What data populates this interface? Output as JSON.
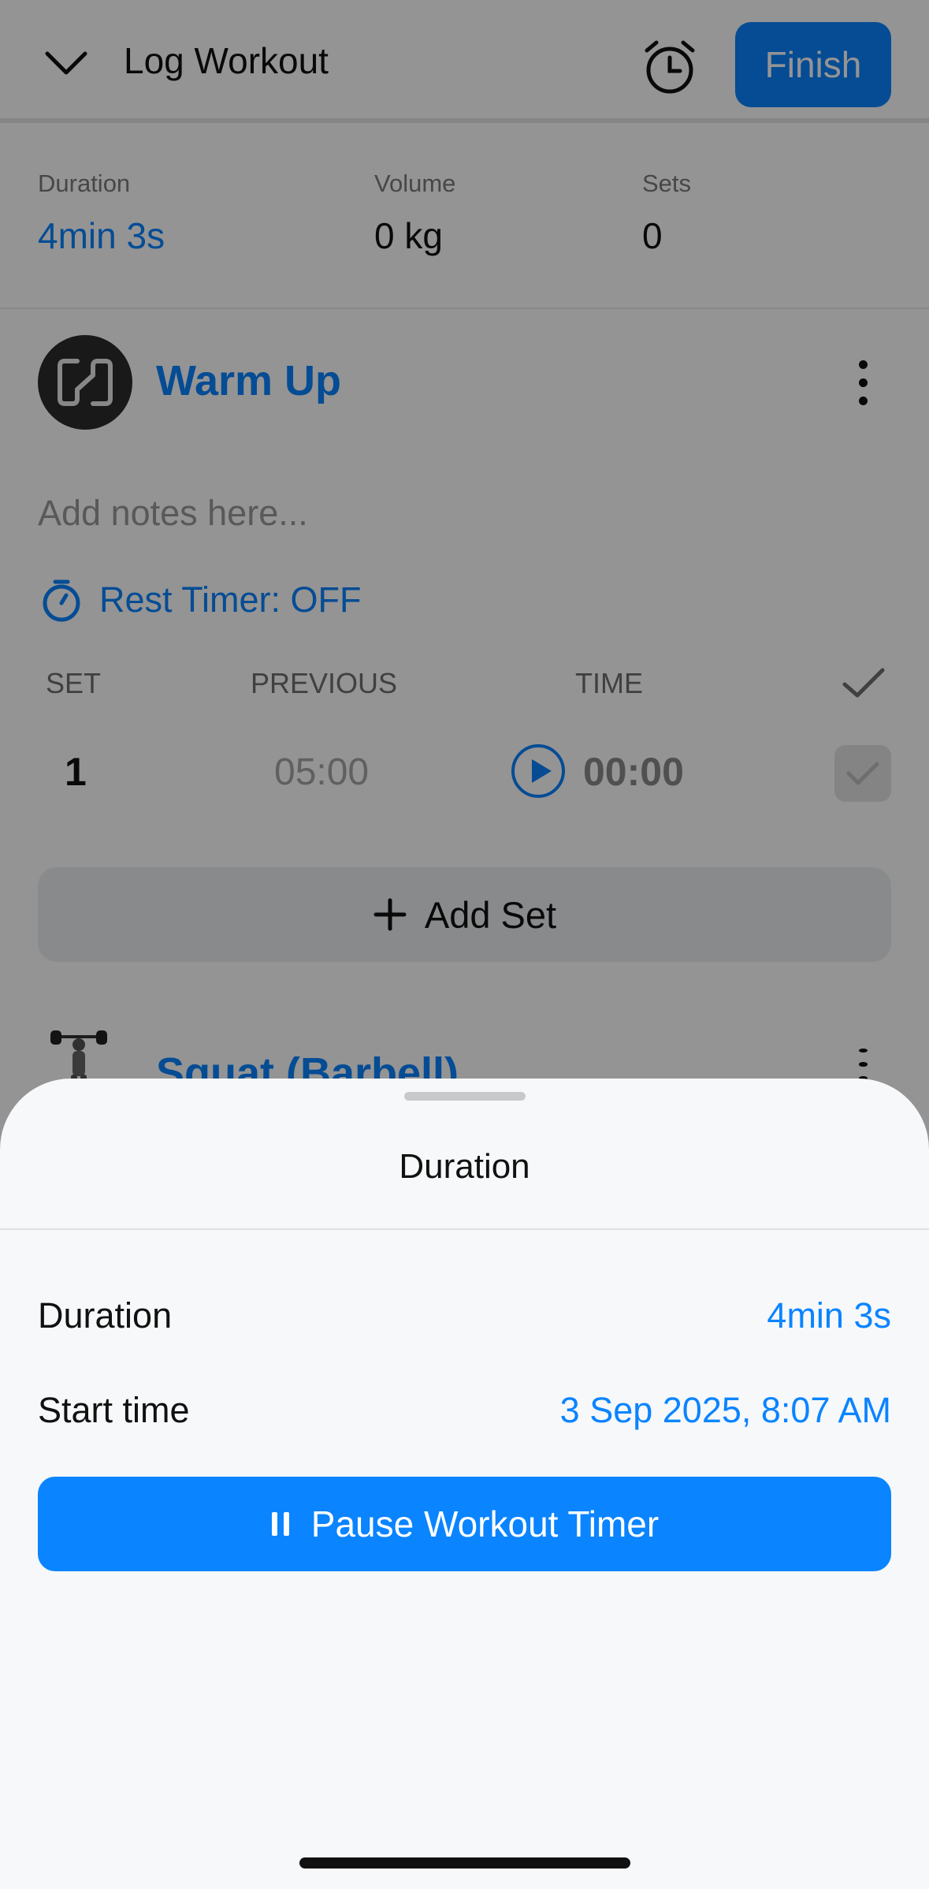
{
  "header": {
    "title": "Log Workout",
    "finish_label": "Finish",
    "collapse_icon": "chevron-down-icon",
    "alarm_icon": "alarm-clock-icon"
  },
  "stats": {
    "duration_label": "Duration",
    "duration_value": "4min 3s",
    "volume_label": "Volume",
    "volume_value": "0 kg",
    "sets_label": "Sets",
    "sets_value": "0"
  },
  "exercise": {
    "title": "Warm Up",
    "notes_placeholder": "Add notes here...",
    "rest_timer": "Rest Timer: OFF",
    "columns": {
      "set": "SET",
      "previous": "PREVIOUS",
      "time": "TIME"
    },
    "sets": [
      {
        "set": "1",
        "previous": "05:00",
        "time": "00:00"
      }
    ],
    "add_set_label": "Add Set"
  },
  "next_exercise": {
    "title": "Squat (Barbell)"
  },
  "sheet": {
    "title": "Duration",
    "duration_label": "Duration",
    "duration_value": "4min 3s",
    "start_label": "Start time",
    "start_value": "3 Sep 2025, 8:07 AM",
    "pause_label": "Pause Workout Timer"
  },
  "colors": {
    "accent": "#0a84ff",
    "overlay": "rgba(0,0,0,0.42)",
    "sheet_bg": "#f6f8fa"
  }
}
